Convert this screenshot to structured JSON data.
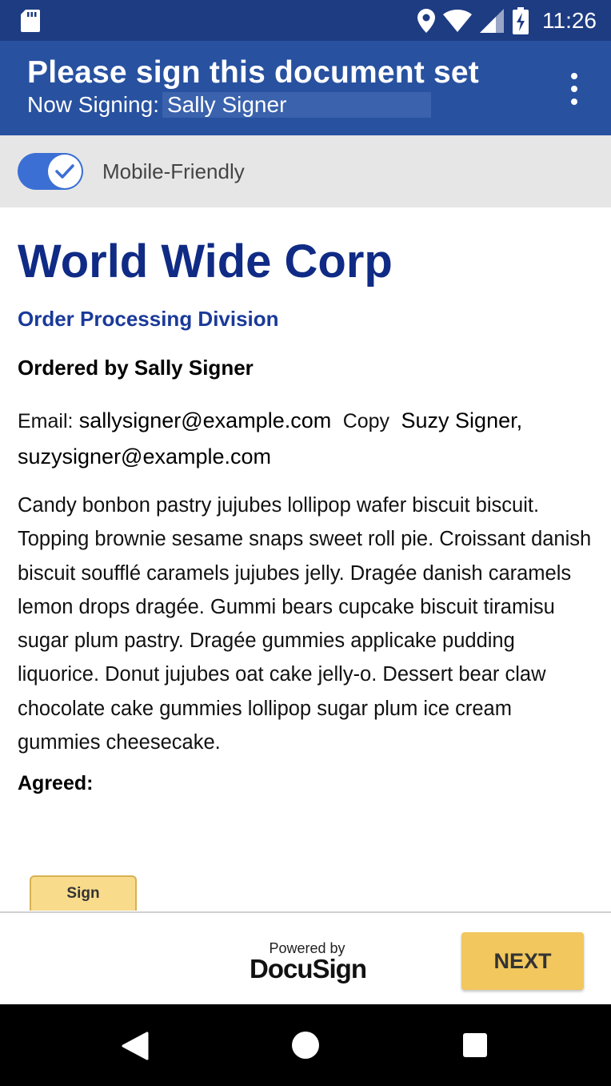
{
  "status_bar": {
    "time": "11:26"
  },
  "app_bar": {
    "title": "Please sign this document set",
    "now_signing_label": "Now Signing:",
    "signer_name": "Sally Signer"
  },
  "toggle": {
    "label": "Mobile-Friendly",
    "checked": true
  },
  "document": {
    "company": "World Wide Corp",
    "division": "Order Processing Division",
    "ordered_by": "Ordered by Sally Signer",
    "email_label": "Email:",
    "email_value": "sallysigner@example.com",
    "copy_label": "Copy",
    "copy_value": "Suzy Signer, suzysigner@example.com",
    "body": "Candy bonbon pastry jujubes lollipop wafer biscuit biscuit. Topping brownie sesame snaps sweet roll pie. Croissant danish biscuit soufflé caramels jujubes jelly. Dragée danish caramels lemon drops dragée. Gummi bears cupcake biscuit tiramisu sugar plum pastry. Dragée gummies applicake pudding liquorice. Donut jujubes oat cake jelly-o. Dessert bear claw chocolate cake gummies lollipop sugar plum ice cream gummies cheesecake.",
    "agreed_label": "Agreed:",
    "sign_tab_label": "Sign"
  },
  "footer": {
    "powered_by": "Powered by",
    "brand": "DocuSign",
    "next_label": "NEXT"
  },
  "colors": {
    "status_bar": "#1e3c82",
    "app_bar": "#2851a0",
    "heading_blue": "#102b85",
    "accent_yellow": "#f1c75e",
    "toggle_blue": "#3b6fd4"
  }
}
